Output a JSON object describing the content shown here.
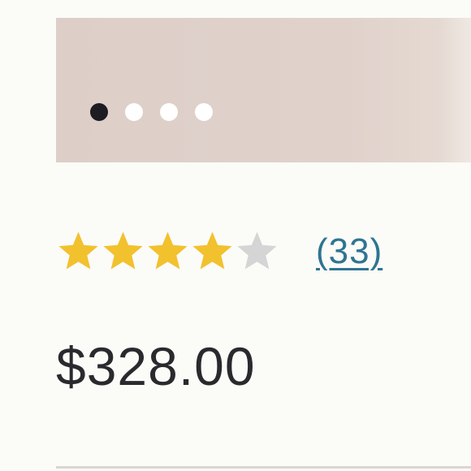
{
  "carousel": {
    "slide_count": 4,
    "active_index": 0
  },
  "rating": {
    "value": 4,
    "max": 5,
    "review_count": "(33)",
    "filled_color": "#f2c12e",
    "empty_color": "#d5d5d5"
  },
  "product": {
    "price": "$328.00"
  },
  "colors": {
    "carousel_bg": "#ddcfc8",
    "active_dot": "#1c1c22",
    "inactive_dot": "#ffffff",
    "link": "#2e7591",
    "text": "#2a2a2e"
  }
}
